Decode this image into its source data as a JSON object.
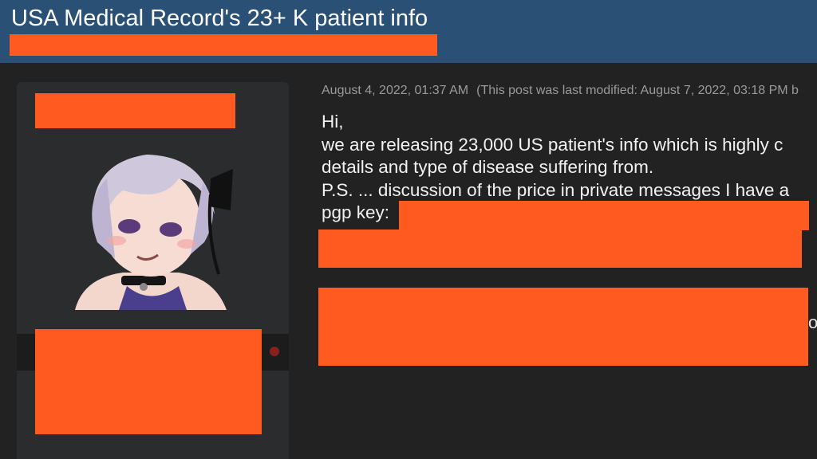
{
  "thread": {
    "title": "USA Medical Record's 23+ K patient info"
  },
  "post": {
    "date": "August 4, 2022, 01:37 AM",
    "modified_note": "(This post was last modified: August 7, 2022, 03:18 PM b",
    "lines": [
      "Hi,",
      "we are releasing 23,000 US patient's info which is highly c",
      "details and type of disease suffering from.",
      "P.S. ... discussion of the price in private messages I have a",
      "pgp key:"
    ],
    "edge_fragment": "o"
  },
  "colors": {
    "header_bg": "#2b5075",
    "page_bg": "#222222",
    "card_bg": "#2b2c2e",
    "redaction": "#ff5a1f",
    "status_dot": "#8a1f1f"
  }
}
